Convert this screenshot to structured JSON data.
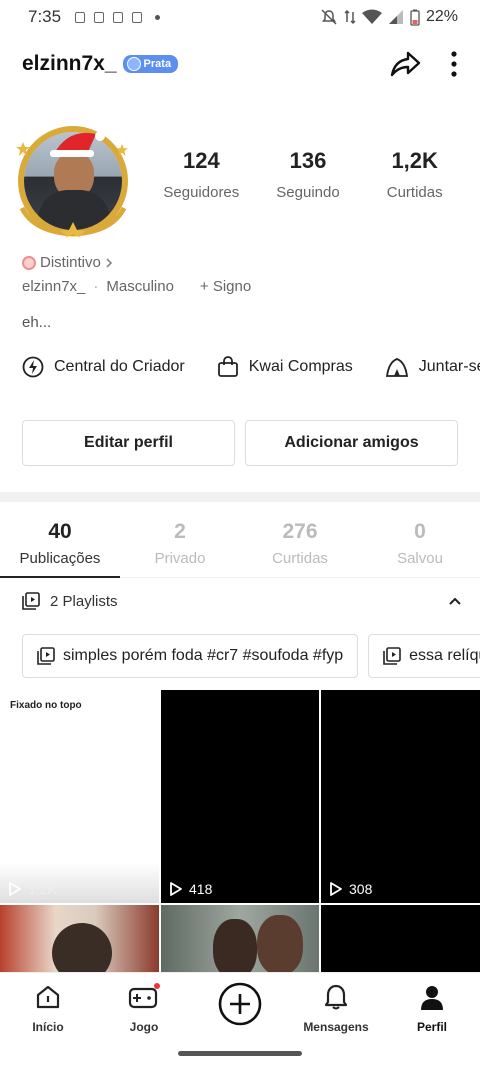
{
  "status": {
    "time": "7:35",
    "battery": "22%"
  },
  "header": {
    "username": "elzinn7x_",
    "badge": "Prata"
  },
  "stats": [
    {
      "value": "124",
      "label": "Seguidores"
    },
    {
      "value": "136",
      "label": "Seguindo"
    },
    {
      "value": "1,2K",
      "label": "Curtidas"
    }
  ],
  "profile": {
    "distintivo": "Distintivo",
    "handle": "elzinn7x_",
    "gender": "Masculino",
    "signo": "+ Signo",
    "bio": "eh..."
  },
  "shortcuts": [
    "Central do Criador",
    "Kwai Compras",
    "Juntar-se"
  ],
  "buttons": {
    "edit": "Editar perfil",
    "add": "Adicionar amigos"
  },
  "tabs": [
    {
      "value": "40",
      "label": "Publicações"
    },
    {
      "value": "2",
      "label": "Privado"
    },
    {
      "value": "276",
      "label": "Curtidas"
    },
    {
      "value": "0",
      "label": "Salvou"
    }
  ],
  "playlists": {
    "header": "2 Playlists",
    "items": [
      "simples porém foda #cr7 #soufoda #fyp",
      "essa relíquia"
    ]
  },
  "grid": {
    "pinned_label": "Fixado no topo",
    "views": [
      "1,2K",
      "418",
      "308"
    ]
  },
  "nav": [
    "Início",
    "Jogo",
    "Mensagens",
    "Perfil"
  ]
}
